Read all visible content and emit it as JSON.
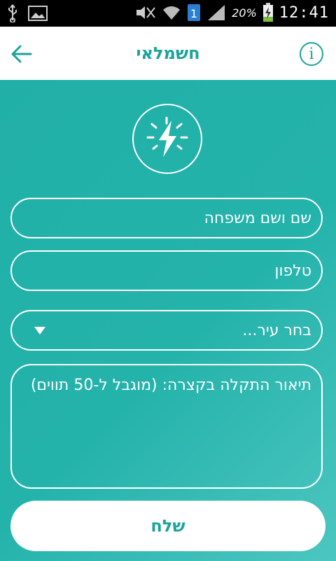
{
  "status_bar": {
    "battery_percent": "20%",
    "time": "12:41",
    "notification_badge": "1"
  },
  "app_bar": {
    "title": "חשמלאי",
    "info_glyph": "i",
    "back_icon": "arrow-left-icon",
    "info_icon": "info-icon"
  },
  "form": {
    "logo_icon": "lightning-bolt-icon",
    "name_placeholder": "שם ושם משפחה",
    "phone_placeholder": "טלפון",
    "city_select_label": "בחר עיר...",
    "description_placeholder": "תיאור התקלה בקצרה: (מוגבל ל-50 תווים)",
    "send_label": "שלח"
  },
  "colors": {
    "accent": "#1aa39a",
    "background_teal": "#24b3ab",
    "text_on_teal": "#ffffff"
  }
}
